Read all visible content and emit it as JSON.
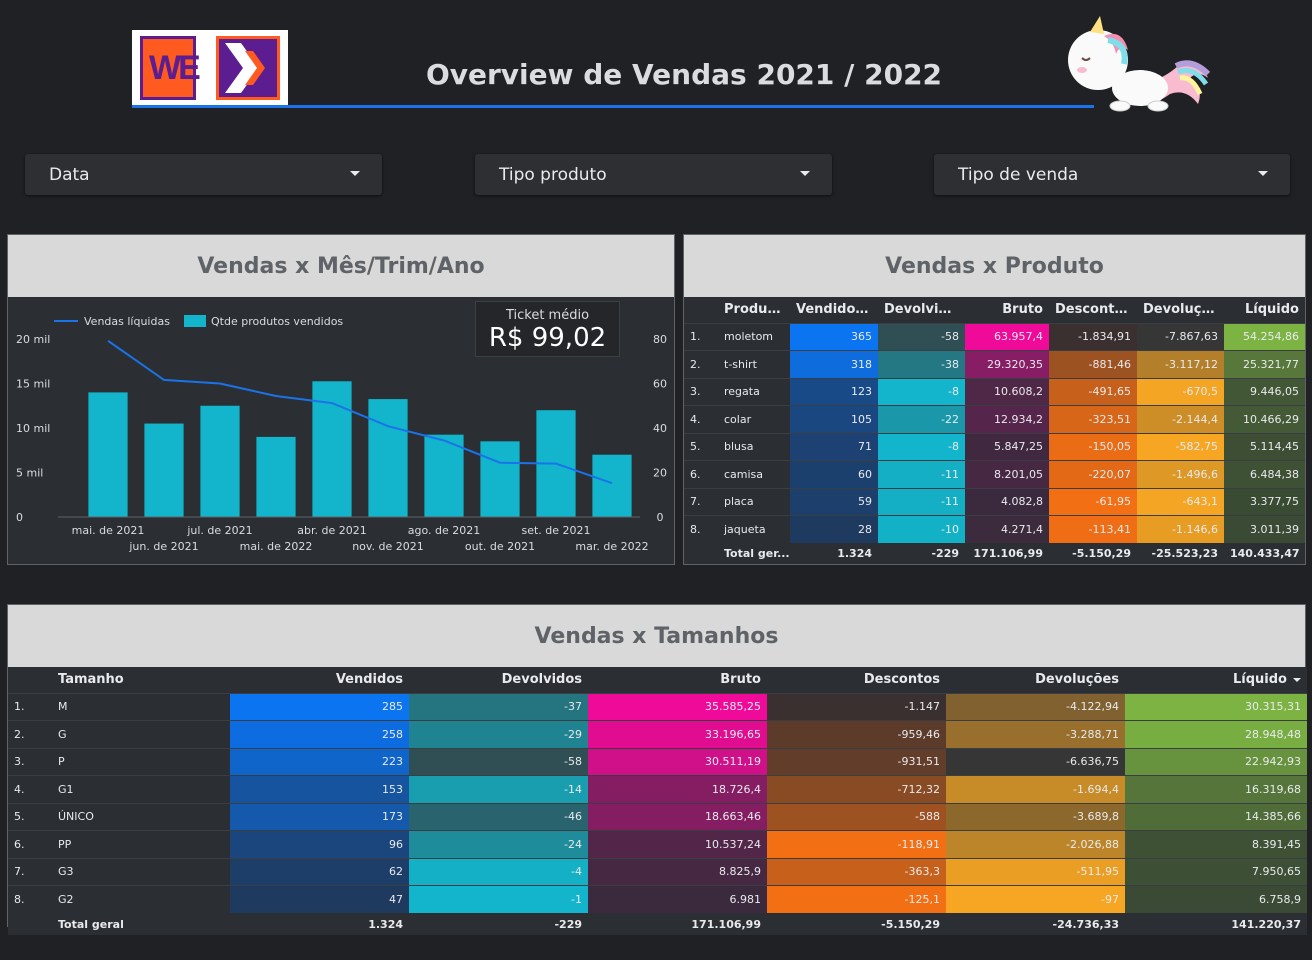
{
  "header": {
    "title": "Overview de Vendas 2021 / 2022",
    "logo_text": "WE"
  },
  "filters": [
    {
      "label": "Data"
    },
    {
      "label": "Tipo produto"
    },
    {
      "label": "Tipo de venda"
    }
  ],
  "panel_month": {
    "title": "Vendas x Mês/Trim/Ano",
    "ticket_label": "Ticket médio",
    "ticket_value": "R$ 99,02"
  },
  "chart_data": {
    "type": "bar",
    "categories": [
      "mai. de 2021",
      "jun. de 2021",
      "jul. de 2021",
      "mai. de 2022",
      "abr. de 2021",
      "nov. de 2021",
      "ago. de 2021",
      "out. de 2021",
      "set. de 2021",
      "mar. de 2022"
    ],
    "series": [
      {
        "name": "Qtde produtos vendidos",
        "type": "bar",
        "axis": "right",
        "color": "#12b5cb",
        "values": [
          56,
          42,
          50,
          36,
          61,
          53,
          37,
          34,
          48,
          28
        ]
      },
      {
        "name": "Vendas líquidas",
        "type": "line",
        "axis": "left",
        "color": "#1a73e8",
        "values": [
          19800,
          15400,
          15000,
          13600,
          12800,
          10200,
          8600,
          6100,
          6000,
          3800
        ]
      }
    ],
    "y_left": {
      "ticks": [
        "0",
        "5 mil",
        "10 mil",
        "15 mil",
        "20 mil"
      ],
      "range": [
        0,
        20000
      ]
    },
    "y_right": {
      "ticks": [
        "0",
        "20",
        "40",
        "60",
        "80"
      ],
      "range": [
        0,
        80
      ]
    },
    "legend": "top-left"
  },
  "panel_product": {
    "title": "Vendas x Produto",
    "columns": [
      "Produto_",
      "Vendidos...",
      "Devolvidos",
      "Bruto",
      "Descontos",
      "Devoluções",
      "Líquido"
    ],
    "rows": [
      {
        "n": "1.",
        "produto": "moletom",
        "vendidos": "365",
        "devolvidos": "-58",
        "bruto": "63.957,4",
        "descontos": "-1.834,91",
        "devolucoes": "-7.867,63",
        "liquido": "54.254,86"
      },
      {
        "n": "2.",
        "produto": "t-shirt",
        "vendidos": "318",
        "devolvidos": "-38",
        "bruto": "29.320,35",
        "descontos": "-881,46",
        "devolucoes": "-3.117,12",
        "liquido": "25.321,77"
      },
      {
        "n": "3.",
        "produto": "regata",
        "vendidos": "123",
        "devolvidos": "-8",
        "bruto": "10.608,2",
        "descontos": "-491,65",
        "devolucoes": "-670,5",
        "liquido": "9.446,05"
      },
      {
        "n": "4.",
        "produto": "colar",
        "vendidos": "105",
        "devolvidos": "-22",
        "bruto": "12.934,2",
        "descontos": "-323,51",
        "devolucoes": "-2.144,4",
        "liquido": "10.466,29"
      },
      {
        "n": "5.",
        "produto": "blusa",
        "vendidos": "71",
        "devolvidos": "-8",
        "bruto": "5.847,25",
        "descontos": "-150,05",
        "devolucoes": "-582,75",
        "liquido": "5.114,45"
      },
      {
        "n": "6.",
        "produto": "camisa",
        "vendidos": "60",
        "devolvidos": "-11",
        "bruto": "8.201,05",
        "descontos": "-220,07",
        "devolucoes": "-1.496,6",
        "liquido": "6.484,38"
      },
      {
        "n": "7.",
        "produto": "placa",
        "vendidos": "59",
        "devolvidos": "-11",
        "bruto": "4.082,8",
        "descontos": "-61,95",
        "devolucoes": "-643,1",
        "liquido": "3.377,75"
      },
      {
        "n": "8.",
        "produto": "jaqueta",
        "vendidos": "28",
        "devolvidos": "-10",
        "bruto": "4.271,4",
        "descontos": "-113,41",
        "devolucoes": "-1.146,6",
        "liquido": "3.011,39"
      }
    ],
    "total": {
      "label": "Total ger...",
      "vendidos": "1.324",
      "devolvidos": "-229",
      "bruto": "171.106,99",
      "descontos": "-5.150,29",
      "devolucoes": "-25.523,23",
      "liquido": "140.433,47"
    }
  },
  "panel_size": {
    "title": "Vendas x Tamanhos",
    "columns": [
      "Tamanho",
      "Vendidos",
      "Devolvidos",
      "Bruto",
      "Descontos",
      "Devoluções",
      "Líquido"
    ],
    "rows": [
      {
        "n": "1.",
        "tam": "M",
        "vendidos": "285",
        "devolvidos": "-37",
        "bruto": "35.585,25",
        "descontos": "-1.147",
        "devolucoes": "-4.122,94",
        "liquido": "30.315,31"
      },
      {
        "n": "2.",
        "tam": "G",
        "vendidos": "258",
        "devolvidos": "-29",
        "bruto": "33.196,65",
        "descontos": "-959,46",
        "devolucoes": "-3.288,71",
        "liquido": "28.948,48"
      },
      {
        "n": "3.",
        "tam": "P",
        "vendidos": "223",
        "devolvidos": "-58",
        "bruto": "30.511,19",
        "descontos": "-931,51",
        "devolucoes": "-6.636,75",
        "liquido": "22.942,93"
      },
      {
        "n": "4.",
        "tam": "G1",
        "vendidos": "153",
        "devolvidos": "-14",
        "bruto": "18.726,4",
        "descontos": "-712,32",
        "devolucoes": "-1.694,4",
        "liquido": "16.319,68"
      },
      {
        "n": "5.",
        "tam": "ÚNICO",
        "vendidos": "173",
        "devolvidos": "-46",
        "bruto": "18.663,46",
        "descontos": "-588",
        "devolucoes": "-3.689,8",
        "liquido": "14.385,66"
      },
      {
        "n": "6.",
        "tam": "PP",
        "vendidos": "96",
        "devolvidos": "-24",
        "bruto": "10.537,24",
        "descontos": "-118,91",
        "devolucoes": "-2.026,88",
        "liquido": "8.391,45"
      },
      {
        "n": "7.",
        "tam": "G3",
        "vendidos": "62",
        "devolvidos": "-4",
        "bruto": "8.825,9",
        "descontos": "-363,3",
        "devolucoes": "-511,95",
        "liquido": "7.950,65"
      },
      {
        "n": "8.",
        "tam": "G2",
        "vendidos": "47",
        "devolvidos": "-1",
        "bruto": "6.981",
        "descontos": "-125,1",
        "devolucoes": "-97",
        "liquido": "6.758,9"
      }
    ],
    "total": {
      "label": "Total geral",
      "vendidos": "1.324",
      "devolvidos": "-229",
      "bruto": "171.106,99",
      "descontos": "-5.150,29",
      "devolucoes": "-24.736,33",
      "liquido": "141.220,37"
    }
  }
}
